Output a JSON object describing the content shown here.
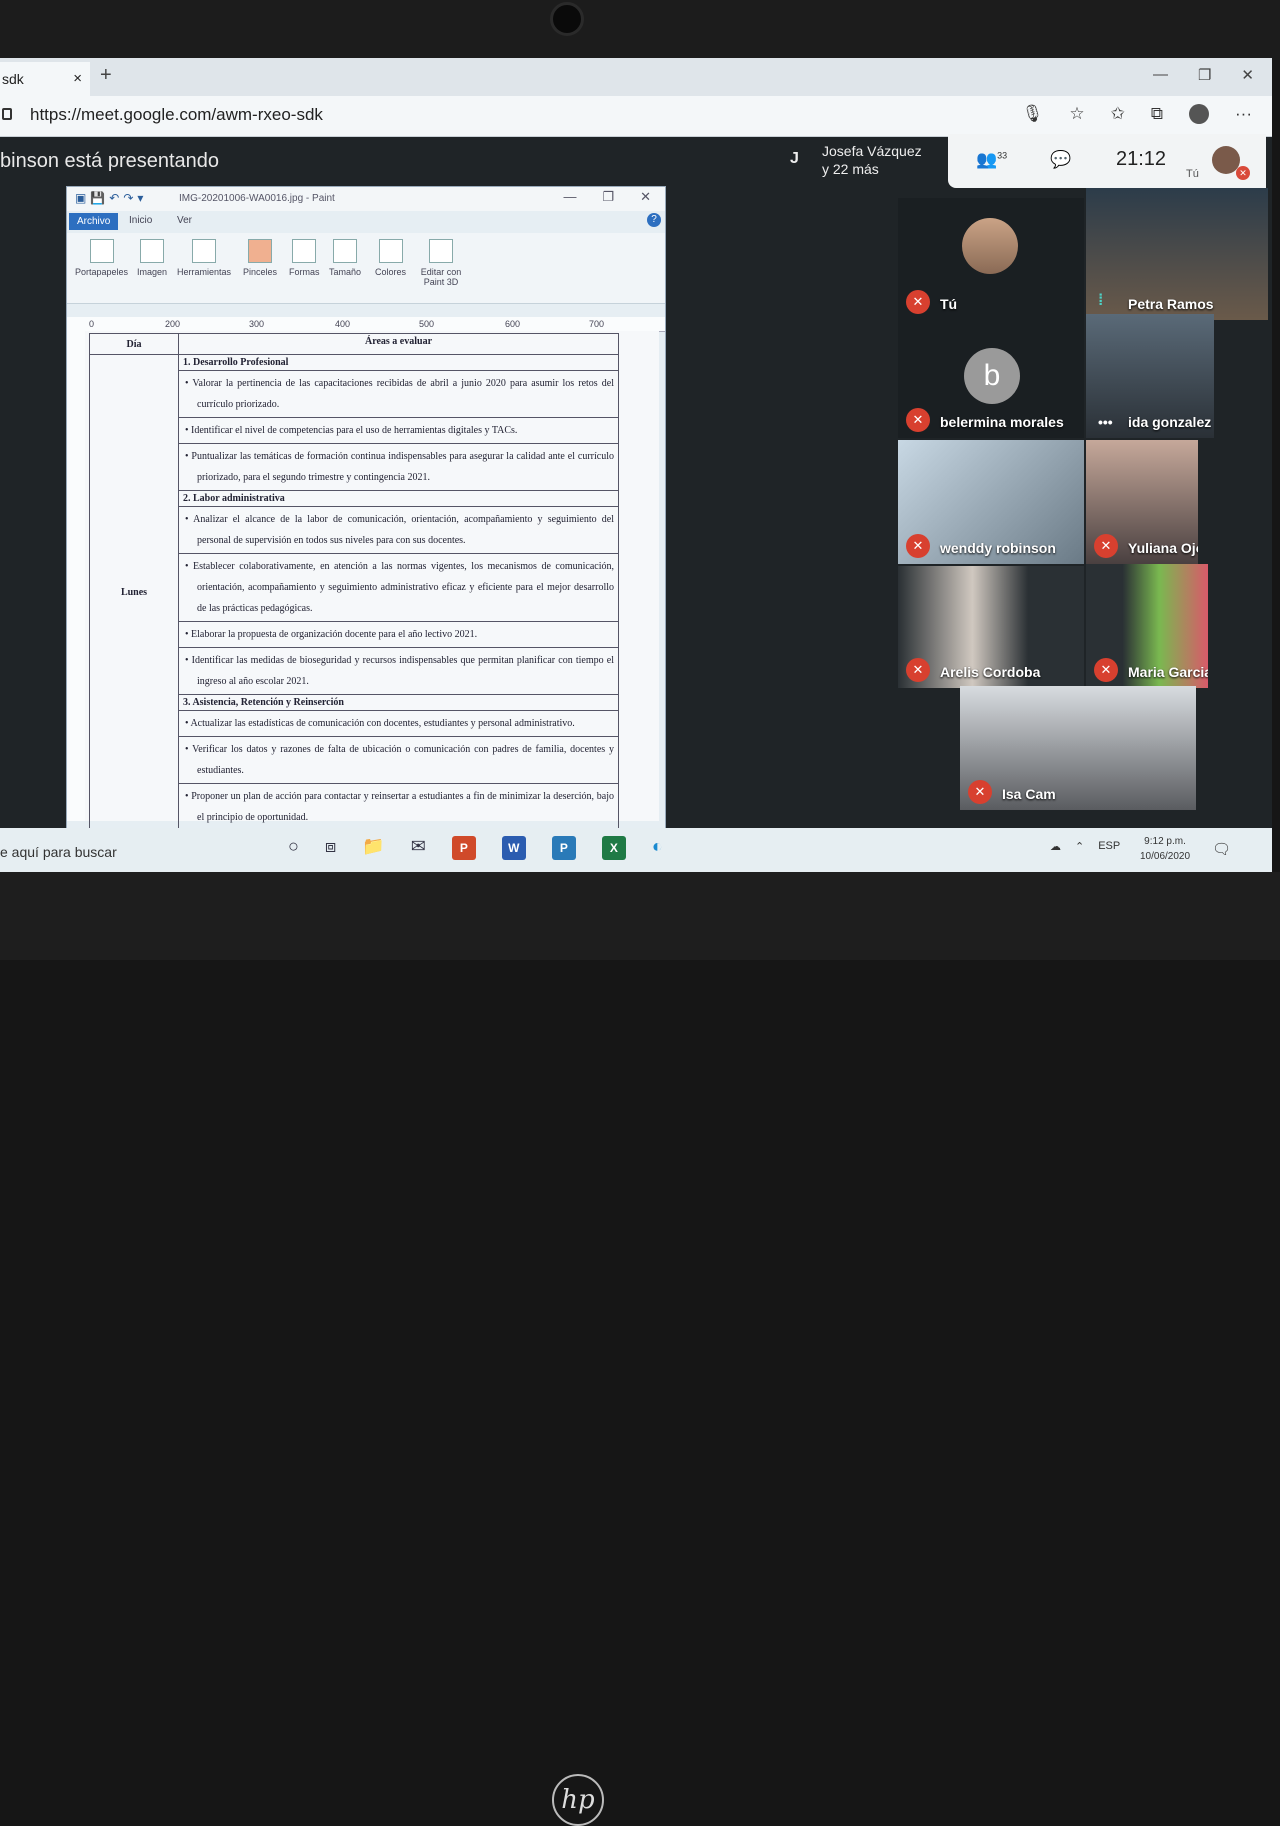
{
  "browser": {
    "tab_title": "sdk",
    "tab_close": "×",
    "new_tab": "+",
    "url": "https://meet.google.com/awm-rxeo-sdk",
    "win_min": "—",
    "win_max": "❐",
    "win_close": "✕"
  },
  "meet": {
    "presenting": "binson está presentando",
    "participant_initial": "J",
    "participant_name": "Josefa Vázquez",
    "participant_more": "y 22 más",
    "people_count": "33",
    "time": "21:12",
    "self_label": "Tú",
    "tiles": [
      {
        "name": "Tú",
        "muted": true
      },
      {
        "name": "Petra Ramos",
        "muted": false
      },
      {
        "name": "belermina morales",
        "initial": "b",
        "muted": true
      },
      {
        "name": "ida gonzalez",
        "muted": false
      },
      {
        "name": "wenddy robinson",
        "muted": true
      },
      {
        "name": "Yuliana Ojo P",
        "muted": true
      },
      {
        "name": "Arelis Cordoba",
        "muted": true
      },
      {
        "name": "Maria Garcia",
        "muted": true
      },
      {
        "name": "Isa Cam",
        "muted": true
      }
    ]
  },
  "paint": {
    "title": "IMG-20201006-WA0016.jpg - Paint",
    "tabs": {
      "file": "Archivo",
      "home": "Inicio",
      "view": "Ver"
    },
    "ribbon": [
      "Portapapeles",
      "Imagen",
      "Herramientas",
      "Pinceles",
      "Formas",
      "Tamaño",
      "Colores",
      "Editar con Paint 3D"
    ],
    "ruler": [
      "0",
      "200",
      "300",
      "400",
      "500",
      "600",
      "700"
    ],
    "doc": {
      "col_day": "Día",
      "col_areas": "Áreas a evaluar",
      "day": "Lunes",
      "sections": [
        {
          "title": "1.   Desarrollo Profesional",
          "items": [
            "Valorar la pertinencia de las capacitaciones recibidas de abril a junio 2020 para asumir los retos del currículo priorizado.",
            "Identificar el nivel de competencias para el uso de herramientas digitales y TACs.",
            "Puntualizar las temáticas de formación continua indispensables para asegurar la calidad ante el currículo priorizado, para el segundo trimestre y contingencia 2021."
          ]
        },
        {
          "title": "2.   Labor administrativa",
          "items": [
            "Analizar el alcance de la labor de comunicación, orientación, acompañamiento y seguimiento del personal de supervisión en todos sus niveles para con sus docentes.",
            "Establecer colaborativamente, en atención a las normas vigentes, los mecanismos de comunicación, orientación, acompañamiento y seguimiento administrativo eficaz y eficiente para el mejor desarrollo de las prácticas pedagógicas.",
            "Elaborar la propuesta de organización docente para el año lectivo 2021.",
            "Identificar las medidas de bioseguridad y recursos indispensables que permitan planificar con tiempo el ingreso al año escolar 2021."
          ]
        },
        {
          "title": "3.   Asistencia, Retención y Reinserción",
          "items": [
            "Actualizar las estadísticas de comunicación con docentes, estudiantes y personal administrativo.",
            "Verificar los datos y razones de falta de ubicación o comunicación con padres de familia, docentes y estudiantes.",
            "Proponer un plan de acción para contactar y reinsertar a estudiantes a fin de minimizar la deserción, bajo el principio de oportunidad."
          ]
        }
      ]
    }
  },
  "taskbar": {
    "search": "e aquí para buscar",
    "lang": "ESP",
    "time": "9:12 p.m.",
    "date": "10/06/2020"
  }
}
